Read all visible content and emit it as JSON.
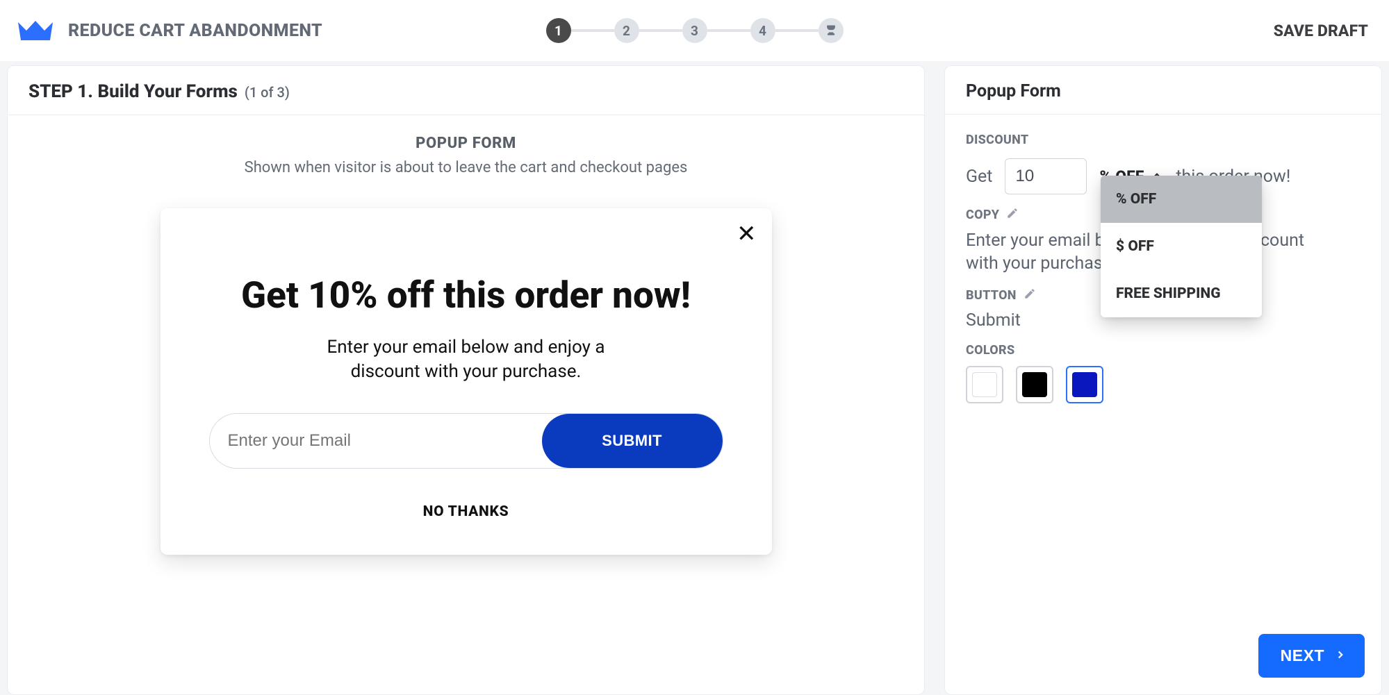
{
  "header": {
    "title": "REDUCE CART ABANDONMENT",
    "save_draft": "SAVE DRAFT",
    "steps": [
      "1",
      "2",
      "3",
      "4"
    ]
  },
  "left_panel": {
    "step_title": "STEP 1. Build Your Forms",
    "step_progress": "(1 of 3)",
    "preview_label": "POPUP FORM",
    "preview_sub": "Shown when visitor is about to leave the cart and checkout pages"
  },
  "popup": {
    "headline": "Get 10% off this order now!",
    "copy_line1": "Enter your email below and enjoy a",
    "copy_line2": "discount with your purchase.",
    "email_placeholder": "Enter your Email",
    "submit_label": "SUBMIT",
    "dismiss_label": "NO THANKS"
  },
  "right_panel": {
    "title": "Popup Form",
    "section_discount": "DISCOUNT",
    "get_label": "Get",
    "discount_value": "10",
    "discount_type_selected": "% OFF",
    "discount_trailing": "this order now!",
    "dropdown": {
      "opt1": "% OFF",
      "opt2": "$ OFF",
      "opt3": "FREE SHIPPING"
    },
    "section_copy": "COPY",
    "copy_text": "Enter your email below and enjoy a discount with your purchase.",
    "section_button": "BUTTON",
    "button_text": "Submit",
    "section_colors": "COLORS",
    "colors": {
      "c1": "#ffffff",
      "c2": "#000000",
      "c3": "#0a17bf"
    },
    "next_label": "NEXT"
  }
}
